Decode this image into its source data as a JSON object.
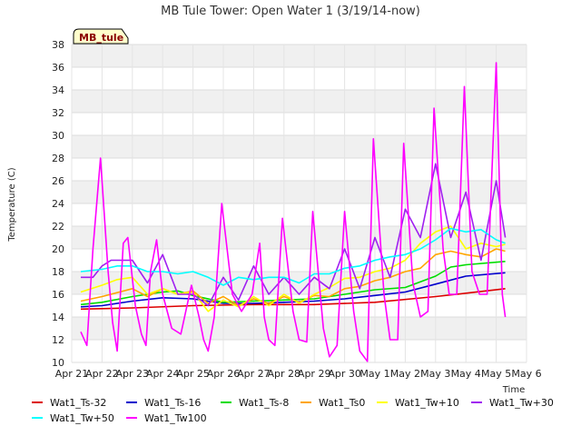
{
  "chart_data": {
    "type": "line",
    "title": "MB Tule Tower: Open Water 1 (3/19/14-now)",
    "xlabel": "Time",
    "ylabel": "Temperature (C)",
    "station_tag": "MB_tule",
    "ylim": [
      10,
      38
    ],
    "y_ticks": [
      10,
      12,
      14,
      16,
      18,
      20,
      22,
      24,
      26,
      28,
      30,
      32,
      34,
      36,
      38
    ],
    "xlim": [
      0,
      15
    ],
    "x_ticks": [
      {
        "value": 0,
        "label": "Apr 21"
      },
      {
        "value": 1,
        "label": "Apr 22"
      },
      {
        "value": 2,
        "label": "Apr 23"
      },
      {
        "value": 3,
        "label": "Apr 24"
      },
      {
        "value": 4,
        "label": "Apr 25"
      },
      {
        "value": 5,
        "label": "Apr 26"
      },
      {
        "value": 6,
        "label": "Apr 27"
      },
      {
        "value": 7,
        "label": "Apr 28"
      },
      {
        "value": 8,
        "label": "Apr 29"
      },
      {
        "value": 9,
        "label": "Apr 30"
      },
      {
        "value": 10,
        "label": "May 1"
      },
      {
        "value": 11,
        "label": "May 2"
      },
      {
        "value": 12,
        "label": "May 3"
      },
      {
        "value": 13,
        "label": "May 4"
      },
      {
        "value": 14,
        "label": "May 5"
      },
      {
        "value": 15,
        "label": "May 6"
      }
    ],
    "grid": true,
    "legend_position": "bottom",
    "series": [
      {
        "name": "Wat1_Ts-32",
        "color": "#dd0000",
        "x": [
          0.3,
          2,
          4,
          6,
          8,
          10,
          12,
          13,
          14.3
        ],
        "y": [
          14.7,
          14.8,
          15.0,
          15.1,
          15.1,
          15.3,
          15.8,
          16.1,
          16.5
        ]
      },
      {
        "name": "Wat1_Ts-16",
        "color": "#0000cc",
        "x": [
          0.3,
          1,
          2,
          3,
          4,
          5,
          6,
          7,
          8,
          9,
          10,
          11,
          12,
          13,
          14.3
        ],
        "y": [
          14.9,
          15.0,
          15.4,
          15.7,
          15.6,
          15.2,
          15.2,
          15.3,
          15.4,
          15.6,
          15.9,
          16.2,
          16.9,
          17.6,
          17.9
        ]
      },
      {
        "name": "Wat1_Ts-8",
        "color": "#00dd00",
        "x": [
          0.3,
          1,
          2,
          3,
          3.5,
          4,
          5,
          6,
          7,
          8,
          9,
          10,
          11,
          12,
          12.5,
          13,
          14.3
        ],
        "y": [
          15.1,
          15.3,
          15.8,
          16.2,
          16.3,
          15.9,
          15.3,
          15.4,
          15.5,
          15.6,
          16.0,
          16.4,
          16.6,
          17.6,
          18.4,
          18.6,
          18.9
        ]
      },
      {
        "name": "Wat1_Ts0",
        "color": "#ffa500",
        "x": [
          0.3,
          1,
          2,
          2.5,
          3,
          3.5,
          4,
          4.5,
          5,
          5.5,
          6,
          6.5,
          7,
          7.5,
          8,
          8.5,
          9,
          9.5,
          10,
          10.5,
          11,
          11.5,
          12,
          12.5,
          13,
          13.5,
          14,
          14.3
        ],
        "y": [
          15.4,
          15.8,
          16.5,
          15.8,
          16.5,
          16.0,
          16.3,
          15.2,
          15.8,
          15.0,
          15.6,
          15.2,
          15.8,
          15.3,
          15.9,
          15.8,
          16.5,
          16.7,
          17.2,
          17.5,
          18.0,
          18.3,
          19.5,
          19.8,
          19.5,
          19.3,
          20.0,
          19.8
        ]
      },
      {
        "name": "Wat1_Tw+10",
        "color": "#ffff00",
        "x": [
          0.3,
          1,
          1.5,
          2,
          2.5,
          3,
          3.5,
          4,
          4.5,
          5,
          5.5,
          6,
          6.5,
          7,
          7.5,
          8,
          8.5,
          9,
          9.5,
          10,
          10.5,
          11,
          11.5,
          12,
          12.5,
          13,
          13.5,
          14,
          14.3
        ],
        "y": [
          16.2,
          16.8,
          17.3,
          17.5,
          16.0,
          16.5,
          16.0,
          16.2,
          14.5,
          15.5,
          14.9,
          15.8,
          15.0,
          16.0,
          15.2,
          16.0,
          16.6,
          17.4,
          17.5,
          18.0,
          18.3,
          19.0,
          20.5,
          21.5,
          22.0,
          20.0,
          20.5,
          20.2,
          20.4
        ]
      },
      {
        "name": "Wat1_Tw+30",
        "color": "#a020f0",
        "x": [
          0.3,
          0.7,
          1,
          1.3,
          2,
          2.5,
          3,
          3.5,
          4,
          4.5,
          5,
          5.5,
          6,
          6.5,
          7,
          7.5,
          8,
          8.5,
          9,
          9.5,
          10,
          10.5,
          11,
          11.5,
          12,
          12.5,
          13,
          13.5,
          14,
          14.3
        ],
        "y": [
          17.5,
          17.5,
          18.5,
          19.0,
          19.0,
          17.0,
          19.5,
          16.0,
          16.0,
          15.0,
          17.5,
          15.5,
          18.5,
          16.0,
          17.5,
          16.0,
          17.5,
          16.5,
          20.0,
          16.5,
          21.0,
          17.5,
          23.5,
          21.0,
          27.5,
          21.0,
          25.0,
          19.0,
          26.0,
          21.0
        ]
      },
      {
        "name": "Wat1_Tw+50",
        "color": "#00ffff",
        "x": [
          0.3,
          1,
          1.5,
          2,
          2.5,
          3,
          3.5,
          4,
          4.5,
          5,
          5.5,
          6,
          6.5,
          7,
          7.5,
          8,
          8.5,
          9,
          9.5,
          10,
          10.5,
          11,
          11.5,
          12,
          12.5,
          13,
          13.5,
          14,
          14.3
        ],
        "y": [
          18.0,
          18.2,
          18.5,
          18.5,
          18.0,
          18.0,
          17.8,
          18.0,
          17.5,
          16.8,
          17.5,
          17.3,
          17.5,
          17.5,
          17.0,
          17.8,
          17.8,
          18.3,
          18.5,
          19.0,
          19.3,
          19.5,
          20.0,
          20.8,
          21.8,
          21.5,
          21.7,
          20.8,
          20.5
        ]
      },
      {
        "name": "Wat1_Tw100",
        "color": "#ff00ff",
        "x": [
          0.3,
          0.5,
          0.7,
          0.95,
          1.2,
          1.35,
          1.5,
          1.7,
          1.85,
          2.1,
          2.3,
          2.45,
          2.6,
          2.8,
          3.0,
          3.3,
          3.6,
          3.95,
          4.2,
          4.35,
          4.5,
          4.7,
          4.95,
          5.3,
          5.6,
          5.95,
          6.2,
          6.35,
          6.5,
          6.7,
          6.95,
          7.3,
          7.5,
          7.75,
          7.95,
          8.3,
          8.5,
          8.75,
          9.0,
          9.3,
          9.5,
          9.75,
          9.95,
          10.3,
          10.5,
          10.75,
          10.95,
          11.25,
          11.5,
          11.75,
          11.95,
          12.25,
          12.45,
          12.7,
          12.95,
          13.2,
          13.45,
          13.7,
          14.0,
          14.2,
          14.3
        ],
        "y": [
          12.7,
          11.5,
          20.0,
          28.0,
          18.0,
          13.5,
          11.0,
          20.5,
          21.0,
          15.0,
          12.5,
          11.5,
          18.0,
          20.8,
          16.0,
          13.0,
          12.5,
          16.8,
          14.0,
          12.0,
          11.0,
          14.0,
          24.0,
          16.0,
          14.5,
          16.0,
          20.5,
          14.0,
          12.0,
          11.5,
          22.7,
          14.5,
          12.0,
          11.8,
          23.3,
          13.0,
          10.5,
          11.5,
          23.3,
          14.5,
          11.0,
          10.1,
          29.7,
          16.0,
          12.0,
          12.0,
          29.3,
          17.0,
          14.0,
          14.5,
          32.4,
          20.0,
          16.0,
          16.0,
          34.3,
          18.0,
          16.0,
          16.0,
          36.4,
          16.0,
          14.0
        ]
      }
    ]
  }
}
